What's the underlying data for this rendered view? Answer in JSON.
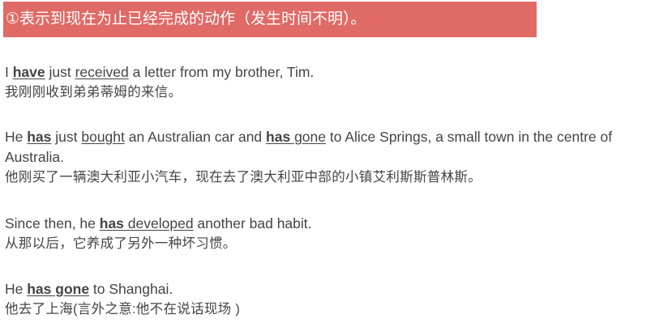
{
  "header": {
    "title": "①表示到现在为止已经完成的动作（发生时间不明）。"
  },
  "examples": [
    {
      "en": [
        {
          "t": "I ",
          "s": ""
        },
        {
          "t": "have",
          "s": "b"
        },
        {
          "t": " just ",
          "s": ""
        },
        {
          "t": "received",
          "s": "u"
        },
        {
          "t": " a letter from my brother, Tim.",
          "s": ""
        }
      ],
      "zh": "我刚刚收到弟弟蒂姆的来信。"
    },
    {
      "en": [
        {
          "t": "He ",
          "s": ""
        },
        {
          "t": "has",
          "s": "b"
        },
        {
          "t": " just ",
          "s": ""
        },
        {
          "t": "bought",
          "s": "u"
        },
        {
          "t": " an Australian car and ",
          "s": ""
        },
        {
          "t": "has",
          "s": "b"
        },
        {
          "t": " ",
          "s": ""
        },
        {
          "t": "gone",
          "s": "u"
        },
        {
          "t": " to Alice Springs, a small town in the centre of Australia.",
          "s": ""
        }
      ],
      "zh": "他刚买了一辆澳大利亚小汽车，现在去了澳大利亚中部的小镇艾利斯斯普林斯。"
    },
    {
      "en": [
        {
          "t": "Since then, he ",
          "s": ""
        },
        {
          "t": "has",
          "s": "b"
        },
        {
          "t": " ",
          "s": ""
        },
        {
          "t": "developed",
          "s": "u"
        },
        {
          "t": " another bad habit.",
          "s": ""
        }
      ],
      "zh": "从那以后，它养成了另外一种坏习惯。"
    },
    {
      "en": [
        {
          "t": "He ",
          "s": ""
        },
        {
          "t": "has gone",
          "s": "b"
        },
        {
          "t": " to Shanghai.",
          "s": ""
        }
      ],
      "zh": "他去了上海(言外之意:他不在说话现场 )"
    }
  ]
}
